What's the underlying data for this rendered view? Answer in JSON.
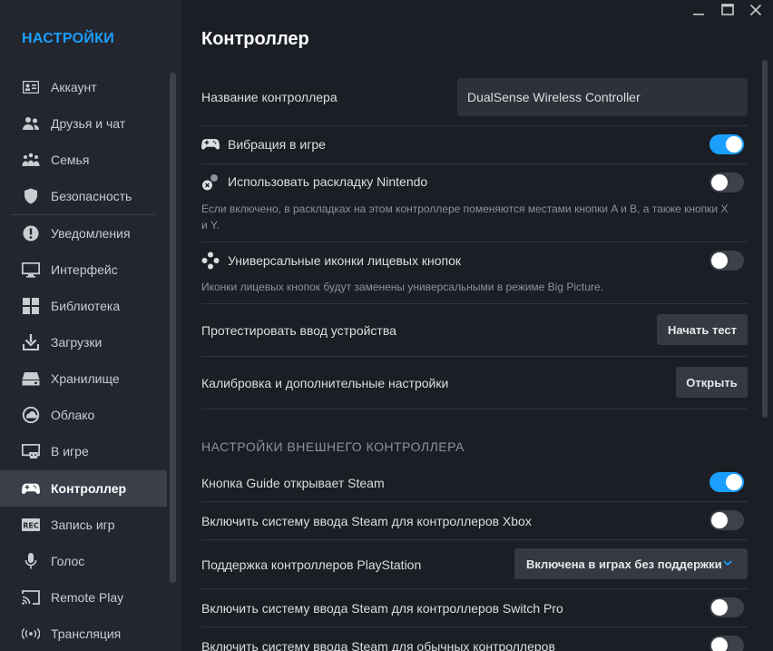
{
  "window": {
    "minimize_icon": "minimize-icon",
    "maximize_icon": "maximize-icon",
    "close_icon": "close-icon"
  },
  "sidebar": {
    "title": "НАСТРОЙКИ",
    "items": [
      {
        "label": "Аккаунт",
        "icon": "account-card-icon"
      },
      {
        "label": "Друзья и чат",
        "icon": "friends-icon"
      },
      {
        "label": "Семья",
        "icon": "family-icon"
      },
      {
        "label": "Безопасность",
        "icon": "shield-icon"
      },
      {
        "label": "Уведомления",
        "icon": "notification-icon"
      },
      {
        "label": "Интерфейс",
        "icon": "monitor-icon"
      },
      {
        "label": "Библиотека",
        "icon": "grid-icon"
      },
      {
        "label": "Загрузки",
        "icon": "download-icon"
      },
      {
        "label": "Хранилище",
        "icon": "drive-icon"
      },
      {
        "label": "Облако",
        "icon": "cloud-icon"
      },
      {
        "label": "В игре",
        "icon": "in-game-icon"
      },
      {
        "label": "Контроллер",
        "icon": "gamepad-icon"
      },
      {
        "label": "Запись игр",
        "icon": "rec-icon"
      },
      {
        "label": "Голос",
        "icon": "microphone-icon"
      },
      {
        "label": "Remote Play",
        "icon": "cast-icon"
      },
      {
        "label": "Трансляция",
        "icon": "broadcast-icon"
      }
    ],
    "active_item": "Контроллер"
  },
  "main": {
    "title": "Контроллер",
    "controller_name_label": "Название контроллера",
    "controller_name_value": "DualSense Wireless Controller",
    "vibration_label": "Вибрация в игре",
    "vibration_on": true,
    "nintendo_label": "Использовать раскладку Nintendo",
    "nintendo_on": false,
    "nintendo_desc": "Если включено, в раскладках на этом контроллере поменяются местами кнопки A и B, а также кнопки X и Y.",
    "universal_icons_label": "Универсальные иконки лицевых кнопок",
    "universal_icons_on": false,
    "universal_icons_desc": "Иконки лицевых кнопок будут заменены универсальными в режиме Big Picture.",
    "test_input_label": "Протестировать ввод устройства",
    "test_input_button": "Начать тест",
    "calibration_label": "Калибровка и дополнительные настройки",
    "calibration_button": "Открыть",
    "external_section_header": "НАСТРОЙКИ ВНЕШНЕГО КОНТРОЛЛЕРА",
    "guide_label": "Кнопка Guide открывает Steam",
    "guide_on": true,
    "xbox_label": "Включить систему ввода Steam для контроллеров Xbox",
    "xbox_on": false,
    "playstation_label": "Поддержка контроллеров PlayStation",
    "playstation_value": "Включена в играх без поддержки",
    "switch_pro_label": "Включить систему ввода Steam для контроллеров Switch Pro",
    "switch_pro_on": false,
    "generic_label": "Включить систему ввода Steam для обычных контроллеров",
    "generic_on": false
  },
  "colors": {
    "accent": "#1a9fff",
    "background": "#1b1e25",
    "sidebar": "#23262e"
  }
}
